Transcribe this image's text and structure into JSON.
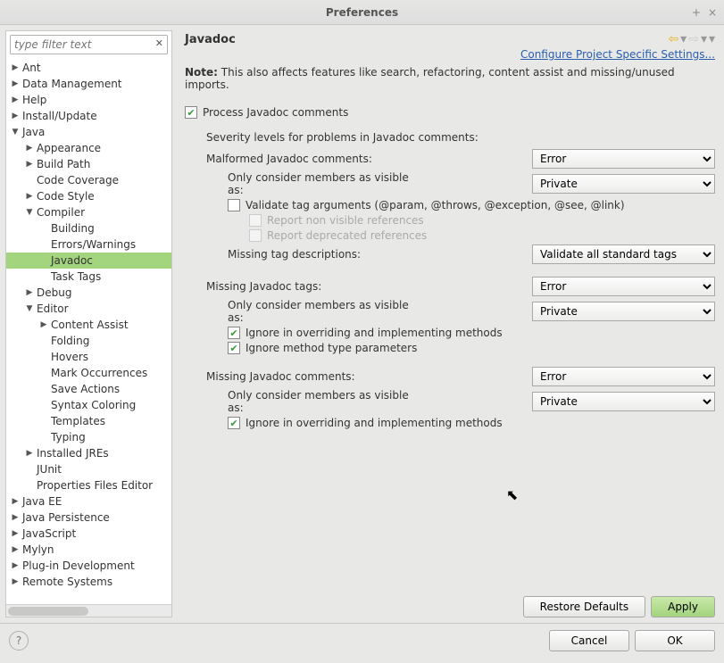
{
  "window": {
    "title": "Preferences"
  },
  "filter": {
    "placeholder": "type filter text"
  },
  "tree": [
    {
      "label": "Ant",
      "indent": 0,
      "arrow": "▶"
    },
    {
      "label": "Data Management",
      "indent": 0,
      "arrow": "▶"
    },
    {
      "label": "Help",
      "indent": 0,
      "arrow": "▶"
    },
    {
      "label": "Install/Update",
      "indent": 0,
      "arrow": "▶"
    },
    {
      "label": "Java",
      "indent": 0,
      "arrow": "▼"
    },
    {
      "label": "Appearance",
      "indent": 1,
      "arrow": "▶"
    },
    {
      "label": "Build Path",
      "indent": 1,
      "arrow": "▶"
    },
    {
      "label": "Code Coverage",
      "indent": 1,
      "arrow": ""
    },
    {
      "label": "Code Style",
      "indent": 1,
      "arrow": "▶"
    },
    {
      "label": "Compiler",
      "indent": 1,
      "arrow": "▼"
    },
    {
      "label": "Building",
      "indent": 2,
      "arrow": ""
    },
    {
      "label": "Errors/Warnings",
      "indent": 2,
      "arrow": ""
    },
    {
      "label": "Javadoc",
      "indent": 2,
      "arrow": "",
      "selected": true
    },
    {
      "label": "Task Tags",
      "indent": 2,
      "arrow": ""
    },
    {
      "label": "Debug",
      "indent": 1,
      "arrow": "▶"
    },
    {
      "label": "Editor",
      "indent": 1,
      "arrow": "▼"
    },
    {
      "label": "Content Assist",
      "indent": 2,
      "arrow": "▶"
    },
    {
      "label": "Folding",
      "indent": 2,
      "arrow": ""
    },
    {
      "label": "Hovers",
      "indent": 2,
      "arrow": ""
    },
    {
      "label": "Mark Occurrences",
      "indent": 2,
      "arrow": ""
    },
    {
      "label": "Save Actions",
      "indent": 2,
      "arrow": ""
    },
    {
      "label": "Syntax Coloring",
      "indent": 2,
      "arrow": ""
    },
    {
      "label": "Templates",
      "indent": 2,
      "arrow": ""
    },
    {
      "label": "Typing",
      "indent": 2,
      "arrow": ""
    },
    {
      "label": "Installed JREs",
      "indent": 1,
      "arrow": "▶"
    },
    {
      "label": "JUnit",
      "indent": 1,
      "arrow": ""
    },
    {
      "label": "Properties Files Editor",
      "indent": 1,
      "arrow": ""
    },
    {
      "label": "Java EE",
      "indent": 0,
      "arrow": "▶"
    },
    {
      "label": "Java Persistence",
      "indent": 0,
      "arrow": "▶"
    },
    {
      "label": "JavaScript",
      "indent": 0,
      "arrow": "▶"
    },
    {
      "label": "Mylyn",
      "indent": 0,
      "arrow": "▶"
    },
    {
      "label": "Plug-in Development",
      "indent": 0,
      "arrow": "▶"
    },
    {
      "label": "Remote Systems",
      "indent": 0,
      "arrow": "▶"
    }
  ],
  "page": {
    "title": "Javadoc",
    "configure_link": "Configure Project Specific Settings...",
    "note_label": "Note:",
    "note_text": "This also affects features like search, refactoring, content assist and missing/unused imports.",
    "process_label": "Process Javadoc comments",
    "severity_heading": "Severity levels for problems in Javadoc comments:",
    "malformed": {
      "label": "Malformed Javadoc comments:",
      "value": "Error",
      "visibility_label": "Only consider members as visible as:",
      "visibility_value": "Private",
      "validate_label": "Validate tag arguments (@param, @throws, @exception, @see, @link)",
      "report_nonvisible": "Report non visible references",
      "report_deprecated": "Report deprecated references",
      "missing_tag_desc_label": "Missing tag descriptions:",
      "missing_tag_desc_value": "Validate all standard tags"
    },
    "missing_tags": {
      "label": "Missing Javadoc tags:",
      "value": "Error",
      "visibility_label": "Only consider members as visible as:",
      "visibility_value": "Private",
      "ignore_override": "Ignore in overriding and implementing methods",
      "ignore_type_params": "Ignore method type parameters"
    },
    "missing_comments": {
      "label": "Missing Javadoc comments:",
      "value": "Error",
      "visibility_label": "Only consider members as visible as:",
      "visibility_value": "Private",
      "ignore_override": "Ignore in overriding and implementing methods"
    },
    "restore_defaults": "Restore Defaults",
    "apply": "Apply"
  },
  "footer": {
    "cancel": "Cancel",
    "ok": "OK"
  }
}
